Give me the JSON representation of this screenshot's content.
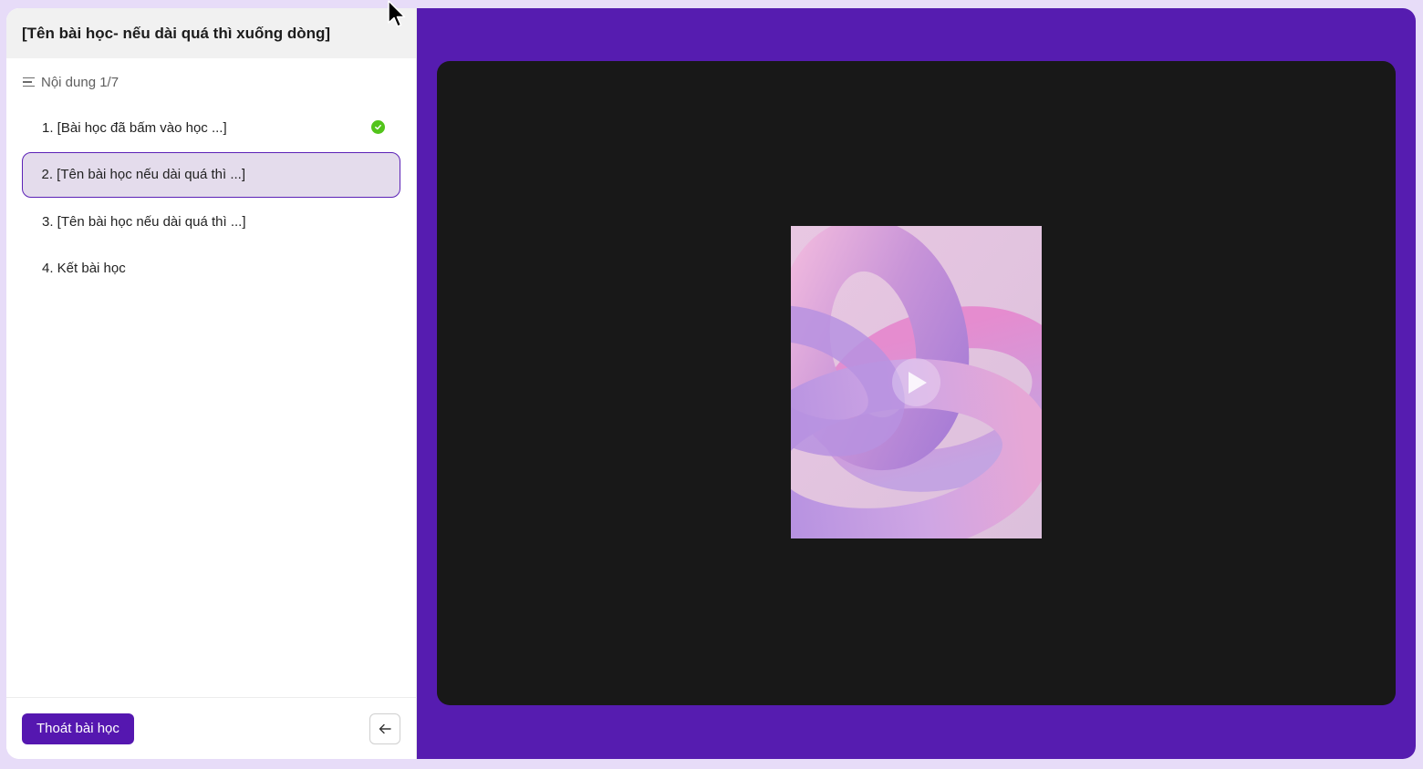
{
  "sidebar": {
    "lesson_title": "[Tên bài học- nếu dài quá thì xuống dòng]",
    "content_counter": "Nội dung 1/7",
    "items": [
      {
        "label": "1. [Bài học đã bấm vào học ...]",
        "status": "completed"
      },
      {
        "label": "2. [Tên bài học nếu dài quá thì ...]",
        "status": "active"
      },
      {
        "label": "3. [Tên bài học nếu dài quá thì ...]",
        "status": "default"
      },
      {
        "label": "4. Kết bài học",
        "status": "default"
      }
    ],
    "exit_label": "Thoát bài học"
  },
  "icons": {
    "menu": "menu-icon",
    "check": "check-circle-icon",
    "back": "arrow-left-icon",
    "play": "play-icon",
    "cursor": "mouse-cursor-icon"
  },
  "colors": {
    "primary": "#561cb0",
    "active_item_bg": "#e4dcec",
    "active_item_border": "#5b21b6",
    "success": "#52c41a",
    "player_bg": "#181818"
  }
}
